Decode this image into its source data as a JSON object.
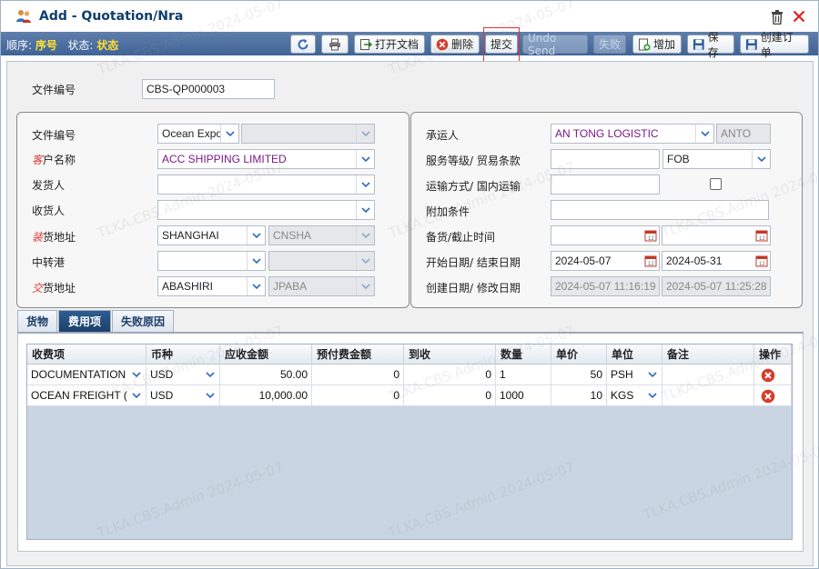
{
  "window": {
    "title": "Add - Quotation/Nra",
    "title_icon": "user-group-icon",
    "trash_icon": "trash-icon",
    "close_icon": "close-icon"
  },
  "toolbar": {
    "seq_label": "顺序:",
    "seq_value": "序号",
    "status_label": "状态:",
    "status_value": "状态",
    "buttons": {
      "refresh": "",
      "print": "",
      "open_doc": "打开文档",
      "delete": "删除",
      "submit": "提交",
      "undo_send": "Undo Send",
      "fail": "失败",
      "add": "增加",
      "save": "保存",
      "create_order": "创建订单"
    }
  },
  "header": {
    "doc_no_label": "文件编号",
    "doc_no_value": "CBS-QP000003"
  },
  "left_panel": {
    "doc_no_label": "文件编号",
    "doc_no_type": "Ocean Expo",
    "doc_no_sub": "",
    "customer_label": "户名称",
    "customer_value": "ACC SHIPPING LIMITED",
    "shipper_label": "发货人",
    "shipper_value": "",
    "consignee_label": "收货人",
    "consignee_value": "",
    "pol_label": "货地址",
    "pol_value": "SHANGHAI",
    "pol_code": "CNSHA",
    "transit_label": "中转港",
    "transit_value": "",
    "transit_code": "",
    "pod_label": "货地址",
    "pod_value": "ABASHIRI",
    "pod_code": "JPABA"
  },
  "right_panel": {
    "carrier_label": "承运人",
    "carrier_value": "AN TONG LOGISTIC",
    "carrier_code": "ANTO",
    "service_label": "服务等级/ 贸易条款",
    "service_value": "",
    "incoterm_value": "FOB",
    "transport_label": "运输方式/ 国内运输",
    "transport_value": "",
    "extra_label": "附加条件",
    "extra_value": "",
    "cutoff_label": "备货/截止时间",
    "cutoff_start": "",
    "cutoff_end": "",
    "date_label": "开始日期/ 结束日期",
    "start_date": "2024-05-07",
    "end_date": "2024-05-31",
    "created_label": "创建日期/ 修改日期",
    "created_value": "2024-05-07 11:16:19",
    "modified_value": "2024-05-07 11:25:28"
  },
  "tabs": [
    {
      "label": "货物"
    },
    {
      "label": "费用项"
    },
    {
      "label": "失败原因"
    }
  ],
  "grid": {
    "headers": [
      "收费项",
      "币种",
      "应收金额",
      "预付费金额",
      "到收",
      "数量",
      "单价",
      "单位",
      "备注",
      "操作"
    ],
    "rows": [
      {
        "item": "DOCUMENTATION",
        "currency": "USD",
        "receivable": "50.00",
        "prepaid": "0",
        "collect": "0",
        "qty": "1",
        "price": "50",
        "unit": "PSH",
        "remark": ""
      },
      {
        "item": "OCEAN FREIGHT (",
        "currency": "USD",
        "receivable": "10,000.00",
        "prepaid": "0",
        "collect": "0",
        "qty": "1000",
        "price": "10",
        "unit": "KGS",
        "remark": ""
      }
    ]
  },
  "watermark": "TLKA.CBS.Admin 2024-05-07",
  "colors": {
    "toolbar": "#4a6ea0",
    "accent_yellow": "#ffe033",
    "required_red": "#e13a3a",
    "customer_purple": "#7a1a8a",
    "highlight_red": "#e33333"
  }
}
